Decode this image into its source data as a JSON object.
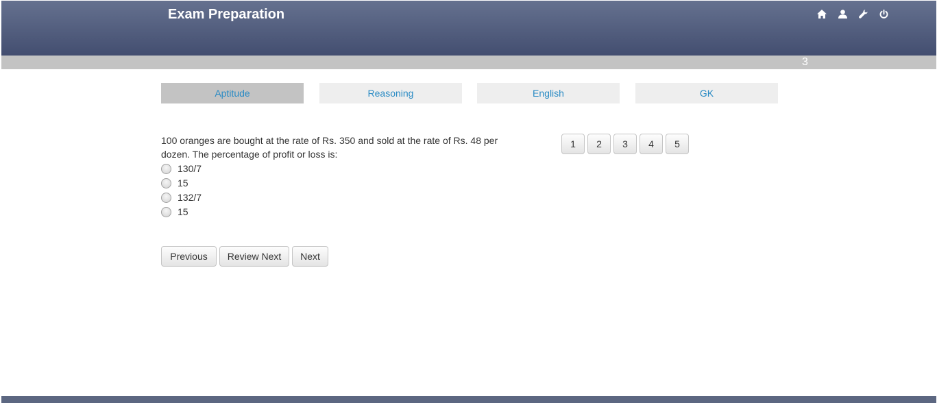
{
  "header": {
    "title": "Exam Preparation",
    "icons": [
      "home-icon",
      "user-icon",
      "wrench-icon",
      "power-icon"
    ]
  },
  "subbar": {
    "counter": "3"
  },
  "tabs": [
    {
      "label": "Aptitude",
      "active": true
    },
    {
      "label": "Reasoning",
      "active": false
    },
    {
      "label": "English",
      "active": false
    },
    {
      "label": "GK",
      "active": false
    }
  ],
  "question": {
    "text": "100 oranges are bought at the rate of Rs. 350 and sold at the rate of Rs. 48 per dozen. The percentage of profit or loss is:",
    "options": [
      "130/7",
      "15",
      "132/7",
      "15"
    ]
  },
  "question_nav": [
    "1",
    "2",
    "3",
    "4",
    "5"
  ],
  "buttons": {
    "previous": "Previous",
    "review_next": "Review Next",
    "next": "Next"
  },
  "colors": {
    "header_top": "#65718f",
    "header_bottom": "#434e70",
    "subbar": "#c3c3c3",
    "tab_text": "#2a8bc4",
    "tab_bg": "#eeeeee",
    "tab_active_bg": "#c3c3c3",
    "footer": "#5c6781"
  }
}
